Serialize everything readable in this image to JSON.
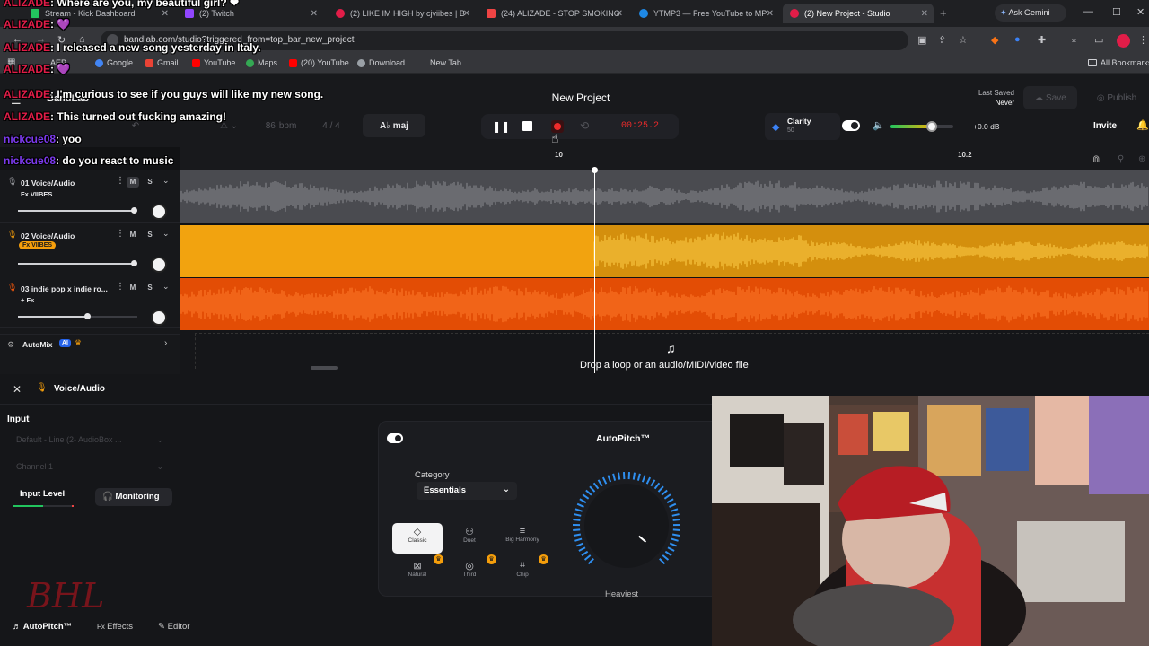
{
  "browser": {
    "tabs": [
      {
        "title": "Stream - Kick Dashboard",
        "color": "#22c55e"
      },
      {
        "title": "(2) Twitch",
        "color": "#9146ff"
      },
      {
        "title": "(2) LIKE IM HIGH by cjviibes | B",
        "color": "#e11d48"
      },
      {
        "title": "(24) ALIZADE - STOP SMOKING",
        "color": "#ef4444"
      },
      {
        "title": "YTMP3 — Free YouTube to MP",
        "color": "#1e88e5"
      },
      {
        "title": "(2) New Project - Studio",
        "color": "#e11d48"
      }
    ],
    "ask_gemini": "Ask Gemini",
    "url": "bandlab.com/studio?triggered_from=top_bar_new_project",
    "bookmarks": [
      "AEP",
      "Google",
      "Gmail",
      "YouTube",
      "Maps",
      "(20) YouTube",
      "Download",
      "New Tab"
    ],
    "all_bookmarks": "All Bookmarks"
  },
  "studio": {
    "app_name": "BandLab",
    "project_title": "New Project",
    "last_saved_label": "Last Saved",
    "last_saved_value": "Never",
    "save_label": "Save",
    "publish_label": "Publish",
    "invite_label": "Invite",
    "tempo": "86",
    "tempo_unit": "bpm",
    "time_sig": "4 / 4",
    "key": "A♭ maj",
    "time_display": "00:25.2",
    "clarity_label": "Clarity",
    "clarity_value": "50",
    "master_db": "+0.0 dB",
    "ruler_marks": [
      "10",
      "10.2"
    ],
    "drop_hint": "Drop a loop or an audio/MIDI/video file",
    "automix_label": "AutoMix",
    "ai_badge": "AI"
  },
  "tracks": [
    {
      "name": "01  Voice/Audio",
      "fx": "Fx VIIBES",
      "volume": 0.97,
      "color": "#4b4c52",
      "wave": "#8a8b90"
    },
    {
      "name": "02  Voice/Audio",
      "fx": "Fx VIIBES",
      "volume": 0.97,
      "color": "#f2a30f",
      "wave": "#ffd24a"
    },
    {
      "name": "03  indie pop x indie ro...",
      "fx": "+ Fx",
      "volume": 0.58,
      "color": "#ff5a0a",
      "wave": "#ff7a2a"
    }
  ],
  "track_buttons": {
    "mute": "M",
    "solo": "S"
  },
  "panel": {
    "track_title": "Voice/Audio",
    "input_label": "Input",
    "input_device": "Default - Line (2- AudioBox ...",
    "channel": "Channel 1",
    "input_level_label": "Input Level",
    "monitoring_label": "Monitoring",
    "effect_title": "AutoPitch™",
    "category_label": "Category",
    "category_value": "Essentials",
    "presets": [
      "Classic",
      "Duet",
      "Big Harmony",
      "Natural",
      "Third",
      "Chip"
    ],
    "knob_label": "Heaviest",
    "bottom_tabs": [
      "AutoPitch™",
      "Effects",
      "Editor"
    ]
  },
  "chat": [
    {
      "user": "ALIZADE",
      "msg": ": Where are you, my beautiful girl? ❤"
    },
    {
      "user": "ALIZADE",
      "msg": ": 💜"
    },
    {
      "user": "ALIZADE",
      "msg": ": I released a new song yesterday in Italy."
    },
    {
      "user": "ALIZADE",
      "msg": ": 💜"
    },
    {
      "user": "ALIZADE",
      "msg": ": I'm curious to see if you guys will like my new song."
    },
    {
      "user": "ALIZADE",
      "msg": ": This turned out fucking amazing!"
    },
    {
      "user": "nickcue08",
      "msg": ": yoo"
    },
    {
      "user": "nickcue08",
      "msg": ": do you react to music"
    }
  ],
  "watermark": "BHL"
}
